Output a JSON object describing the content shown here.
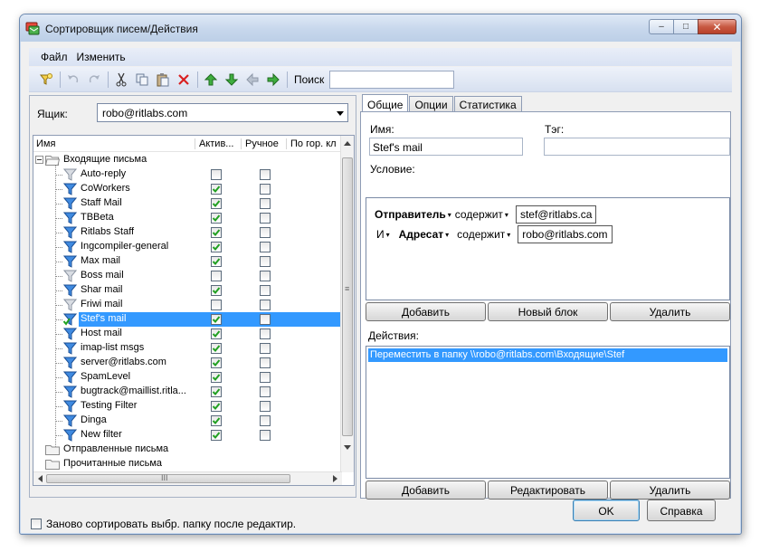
{
  "window": {
    "title": "Сортировщик писем/Действия",
    "minimize": "–",
    "maximize": "□",
    "close": "✕"
  },
  "menu": {
    "items": [
      {
        "label": "Файл"
      },
      {
        "label": "Изменить"
      }
    ]
  },
  "toolbar": {
    "search_label": "Поиск",
    "search_value": ""
  },
  "left": {
    "mailbox_label": "Ящик:",
    "mailbox_value": "robo@ritlabs.com",
    "columns": [
      "Имя",
      "Актив...",
      "Ручное",
      "По гор. кл"
    ],
    "root_folder": "Входящие письма",
    "filters": [
      {
        "name": "Auto-reply",
        "active": false,
        "manual": false,
        "icon": "filter-grey"
      },
      {
        "name": "CoWorkers",
        "active": true,
        "manual": false,
        "icon": "filter-blue"
      },
      {
        "name": "Staff Mail",
        "active": true,
        "manual": false,
        "icon": "filter-blue"
      },
      {
        "name": "TBBeta",
        "active": true,
        "manual": false,
        "icon": "filter-blue"
      },
      {
        "name": "Ritlabs Staff",
        "active": true,
        "manual": false,
        "icon": "filter-blue"
      },
      {
        "name": "Ingcompiler-general",
        "active": true,
        "manual": false,
        "icon": "filter-blue"
      },
      {
        "name": "Max mail",
        "active": true,
        "manual": false,
        "icon": "filter-blue"
      },
      {
        "name": "Boss mail",
        "active": false,
        "manual": false,
        "icon": "filter-grey"
      },
      {
        "name": "Shar mail",
        "active": true,
        "manual": false,
        "icon": "filter-blue"
      },
      {
        "name": "Friwi mail",
        "active": false,
        "manual": false,
        "icon": "filter-grey"
      },
      {
        "name": "Stef's mail",
        "active": true,
        "manual": false,
        "icon": "filter-green",
        "selected": true
      },
      {
        "name": "Host mail",
        "active": true,
        "manual": false,
        "icon": "filter-blue"
      },
      {
        "name": "imap-list msgs",
        "active": true,
        "manual": false,
        "icon": "filter-blue"
      },
      {
        "name": "server@ritlabs.com",
        "active": true,
        "manual": false,
        "icon": "filter-blue"
      },
      {
        "name": "SpamLevel",
        "active": true,
        "manual": false,
        "icon": "filter-blue"
      },
      {
        "name": "bugtrack@maillist.ritla...",
        "active": true,
        "manual": false,
        "icon": "filter-blue"
      },
      {
        "name": "Testing Filter",
        "active": true,
        "manual": false,
        "icon": "filter-blue"
      },
      {
        "name": "Dinga",
        "active": true,
        "manual": false,
        "icon": "filter-blue"
      },
      {
        "name": "New filter",
        "active": true,
        "manual": false,
        "icon": "filter-blue"
      }
    ],
    "other_folders": [
      "Отправленные письма",
      "Прочитанные письма"
    ],
    "scroll_grip": "≡",
    "hscroll_grip": "III",
    "resort_label": "Заново сортировать выбр. папку после редактир."
  },
  "tabs": [
    {
      "label": "Общие",
      "active": true
    },
    {
      "label": "Опции",
      "active": false
    },
    {
      "label": "Статистика",
      "active": false
    }
  ],
  "general": {
    "name_label": "Имя:",
    "name_value": "Stef's mail",
    "tag_label": "Тэг:",
    "tag_value": "",
    "condition_label": "Условие:",
    "conditions": [
      {
        "prefix": "",
        "field": "Отправитель",
        "op": "содержит",
        "value": "stef@ritlabs.ca"
      },
      {
        "prefix": "И",
        "field": "Адресат",
        "op": "содержит",
        "value": "robo@ritlabs.com"
      }
    ],
    "cond_buttons": [
      "Добавить",
      "Новый блок",
      "Удалить"
    ],
    "actions_label": "Действия:",
    "actions": [
      "Переместить в папку \\\\robo@ritlabs.com\\Входящие\\Stef"
    ],
    "action_buttons": [
      "Добавить",
      "Редактировать",
      "Удалить"
    ]
  },
  "dialog": {
    "ok": "OK",
    "help": "Справка"
  }
}
